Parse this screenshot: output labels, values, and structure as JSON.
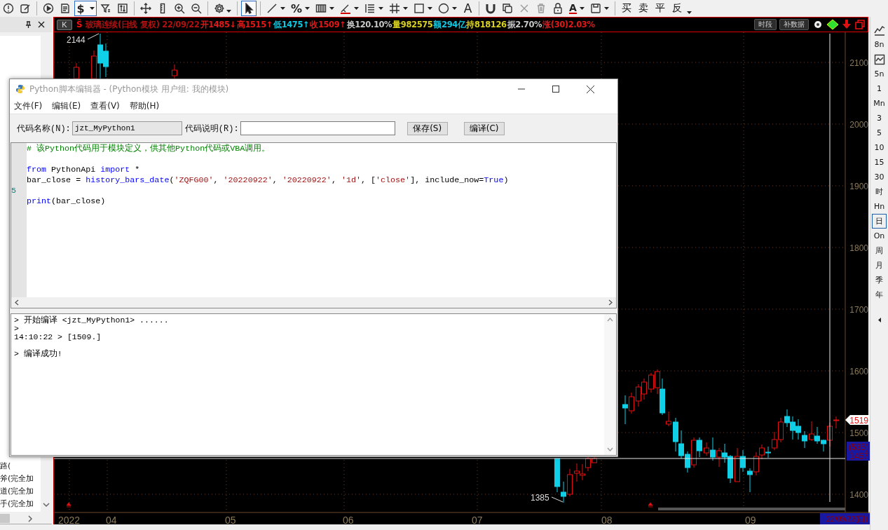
{
  "toolbar": {
    "dollar_tool": {
      "label": "$",
      "selected": true
    },
    "pointer_tool": {
      "selected": true
    },
    "percent_tool": {
      "label": "%"
    },
    "text_tool": {
      "label": "A"
    },
    "font_color_tool": {
      "label": "A"
    },
    "trade_buttons": [
      "买",
      "卖",
      "平",
      "反"
    ]
  },
  "left_panel": {
    "items": [
      "路(",
      "斧(完全加",
      "道(完全加",
      "手(完全加"
    ]
  },
  "chart": {
    "period_button": "K",
    "symbol_mark": "Ŝ",
    "quote": [
      {
        "text": "玻璃连续(日线 复权) 22/09/22",
        "color": "#b01010"
      },
      {
        "text": "开1485↓",
        "color": "#e01818"
      },
      {
        "text": "高1515↑",
        "color": "#e01818"
      },
      {
        "text": "低1475↑",
        "color": "#10c8e0"
      },
      {
        "text": "收1509↑",
        "color": "#e01818"
      },
      {
        "text": "换120.10%",
        "color": "#c8c8c8"
      },
      {
        "text": "量982575",
        "color": "#d8d020"
      },
      {
        "text": "额294亿",
        "color": "#10c8e0"
      },
      {
        "text": "持818126",
        "color": "#d8d020"
      },
      {
        "text": "振2.70%",
        "color": "#c8c8c8"
      },
      {
        "text": "涨(30)2.03%",
        "color": "#e01818"
      }
    ],
    "buttons": [
      "时段",
      "补数据"
    ],
    "price_labels": [
      "2100",
      "2000",
      "1900",
      "1800",
      "1700",
      "1600",
      "1500",
      "1400"
    ],
    "high_label": "2144",
    "low_label": "1385",
    "current_price": "1519",
    "cursor_count": "(535)",
    "cursor_price": "1457",
    "date_labels": [
      "2022",
      "04",
      "05",
      "06",
      "07",
      "08",
      "09"
    ],
    "cursor_date": "22/09/22(四)"
  },
  "period_bar": {
    "items": [
      {
        "label": "8n",
        "selected": false
      },
      {
        "label": "5n",
        "selected": false
      },
      {
        "label": "1",
        "selected": false
      },
      {
        "label": "Mn",
        "selected": false
      },
      {
        "label": "3",
        "selected": false
      },
      {
        "label": "5",
        "selected": false
      },
      {
        "label": "10",
        "selected": false
      },
      {
        "label": "15",
        "selected": false
      },
      {
        "label": "30",
        "selected": false
      },
      {
        "label": "时",
        "selected": false
      },
      {
        "label": "Hn",
        "selected": false
      },
      {
        "label": "日",
        "selected": true
      },
      {
        "label": "On",
        "selected": false
      },
      {
        "label": "周",
        "selected": false
      },
      {
        "label": "月",
        "selected": false
      },
      {
        "label": "季",
        "selected": false
      },
      {
        "label": "年",
        "selected": false
      }
    ]
  },
  "editor": {
    "title": "Python脚本编辑器 - (Python模块 用户组: 我的模块)",
    "menu": [
      "文件(F)",
      "编辑(E)",
      "查看(V)",
      "帮助(H)"
    ],
    "name_label": "代码名称(N):",
    "name_value": "jzt_MyPython1",
    "desc_label": "代码说明(R):",
    "buttons": [
      "保存(S)",
      "编译(C)"
    ],
    "code_lines": [
      {
        "kind": "code",
        "tokens": [
          {
            "kind": "comment",
            "text": "# 该Python代码用于模块定义，供其他Python代码或VBA调用。"
          }
        ]
      },
      {
        "kind": "blank"
      },
      {
        "kind": "code",
        "tokens": [
          {
            "kind": "keyword",
            "text": "from"
          },
          {
            "kind": "plain",
            "text": " PythonApi "
          },
          {
            "kind": "keyword",
            "text": "import"
          },
          {
            "kind": "plain",
            "text": " *"
          }
        ]
      },
      {
        "kind": "code",
        "tokens": [
          {
            "kind": "plain",
            "text": "bar_close = "
          },
          {
            "kind": "func",
            "text": "history_bars_date"
          },
          {
            "kind": "plain",
            "text": "("
          },
          {
            "kind": "string",
            "text": "'ZQFG00'"
          },
          {
            "kind": "plain",
            "text": ", "
          },
          {
            "kind": "string",
            "text": "'20220922'"
          },
          {
            "kind": "plain",
            "text": ", "
          },
          {
            "kind": "string",
            "text": "'20220922'"
          },
          {
            "kind": "plain",
            "text": ", "
          },
          {
            "kind": "string",
            "text": "'1d'"
          },
          {
            "kind": "plain",
            "text": ", ["
          },
          {
            "kind": "string",
            "text": "'close'"
          },
          {
            "kind": "plain",
            "text": "], include_now="
          },
          {
            "kind": "keyword",
            "text": "True"
          },
          {
            "kind": "plain",
            "text": ")"
          }
        ]
      },
      {
        "kind": "blank",
        "number": "5"
      },
      {
        "kind": "code",
        "tokens": [
          {
            "kind": "func",
            "text": "print"
          },
          {
            "kind": "plain",
            "text": "(bar_close)"
          }
        ]
      }
    ],
    "output_lines": [
      {
        "kind": "text",
        "text": "> 开始编译 <jzt_MyPython1> ......"
      },
      {
        "kind": "text",
        "text": ">"
      },
      {
        "kind": "text",
        "text": "14:10:22 > [1509.]"
      },
      {
        "kind": "blank"
      },
      {
        "kind": "text",
        "text": "> 编译成功!"
      }
    ]
  }
}
